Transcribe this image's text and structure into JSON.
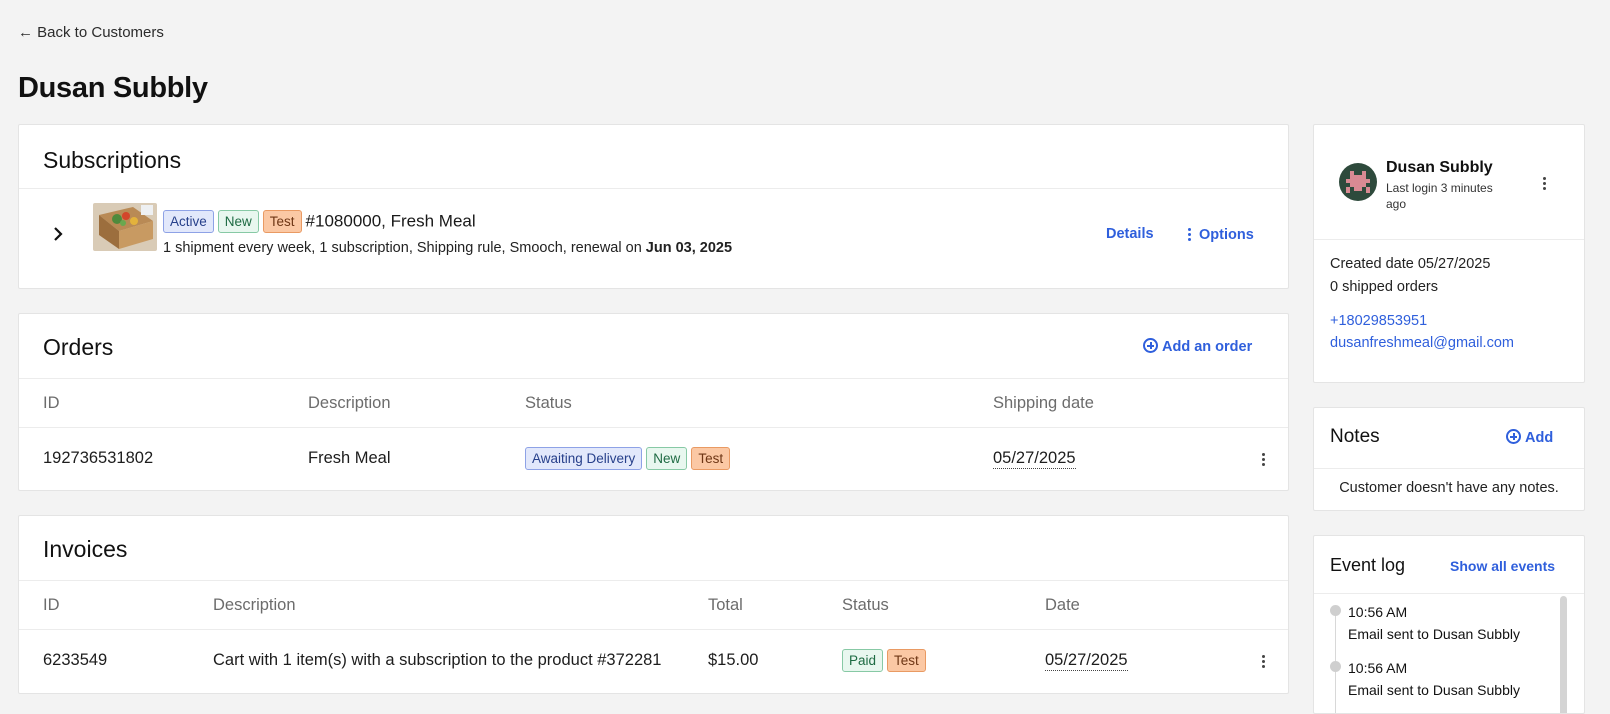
{
  "back_link": "← Back to Customers",
  "page_title": "Dusan Subbly",
  "subscriptions": {
    "title": "Subscriptions",
    "item": {
      "badges": [
        "Active",
        "New",
        "Test"
      ],
      "name": "#1080000, Fresh Meal",
      "summary": "1 shipment every week, 1 subscription, Shipping rule, Smooch, renewal on",
      "renewal_date": "Jun 03, 2025",
      "details_label": "Details",
      "options_label": "Options",
      "thumbnail_icon": "meal-box-thumbnail"
    }
  },
  "orders": {
    "title": "Orders",
    "add_label": "Add an order",
    "columns": [
      "ID",
      "Description",
      "Status",
      "Shipping date"
    ],
    "rows": [
      {
        "id": "192736531802",
        "description": "Fresh Meal",
        "status_badges": [
          "Awaiting Delivery",
          "New",
          "Test"
        ],
        "shipping_date": "05/27/2025"
      }
    ]
  },
  "invoices": {
    "title": "Invoices",
    "columns": [
      "ID",
      "Description",
      "Total",
      "Status",
      "Date"
    ],
    "rows": [
      {
        "id": "6233549",
        "description": "Cart with 1 item(s) with a subscription to the product #372281",
        "total": "$15.00",
        "status_badges": [
          "Paid",
          "Test"
        ],
        "date": "05/27/2025"
      }
    ]
  },
  "profile": {
    "name": "Dusan Subbly",
    "last_login": "Last login 3 minutes ago",
    "created": "Created date 05/27/2025",
    "shipped_orders": "0 shipped orders",
    "phone": "+18029853951",
    "email": "dusanfreshmeal@gmail.com",
    "avatar_color": "#2e4a3c",
    "avatar_accent": "#d98a93"
  },
  "notes": {
    "title": "Notes",
    "add_label": "Add",
    "empty_text": "Customer doesn't have any notes."
  },
  "event_log": {
    "title": "Event log",
    "show_all_label": "Show all events",
    "events": [
      {
        "time": "10:56 AM",
        "text": "Email sent to Dusan Subbly"
      },
      {
        "time": "10:56 AM",
        "text": "Email sent to Dusan Subbly"
      }
    ]
  },
  "colors": {
    "accent": "#2f5fdc",
    "badge_blue": "#e2e8fb",
    "badge_green": "#e8f7ef",
    "badge_orange": "#fbc8a4",
    "background": "#f3f3f3"
  }
}
